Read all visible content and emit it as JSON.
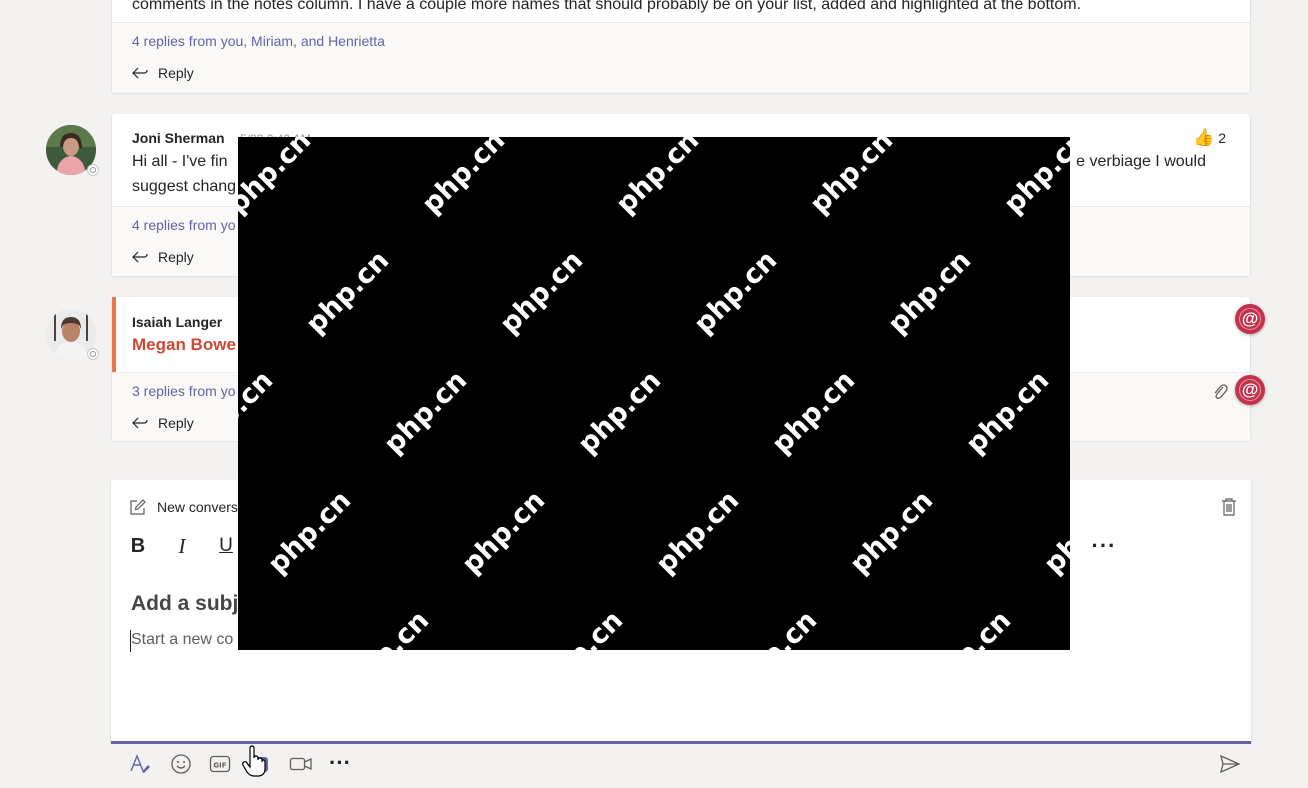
{
  "thread1": {
    "body_tail": "comments in the notes column. I have a couple more names that should probably be on your list, added and highlighted at the bottom.",
    "replies_summary": "4 replies from you, Miriam, and Henrietta",
    "reply_label": "Reply"
  },
  "thread2": {
    "sender": "Joni Sherman",
    "timestamp": "5/23 2:40 AM",
    "body_line1_start": "Hi all - I've fin",
    "body_line1_end": "e verbiage I would",
    "body_line2": "suggest chang",
    "reaction_emoji": "👍",
    "reaction_count": "2",
    "replies_summary": "4 replies from yo",
    "reply_label": "Reply"
  },
  "thread3": {
    "sender": "Isaiah Langer",
    "mention": "Megan Bowe",
    "replies_summary": "3 replies from yo",
    "reply_label": "Reply"
  },
  "compose": {
    "header_label": "New convers",
    "subject_placeholder": "Add a subj",
    "body_placeholder": "Start a new co"
  },
  "watermark_text": "php.cn",
  "colors": {
    "accent": "#6264a7",
    "mention": "#c4314b",
    "mention_name": "#cc4a31",
    "important_bar": "#e97548"
  }
}
